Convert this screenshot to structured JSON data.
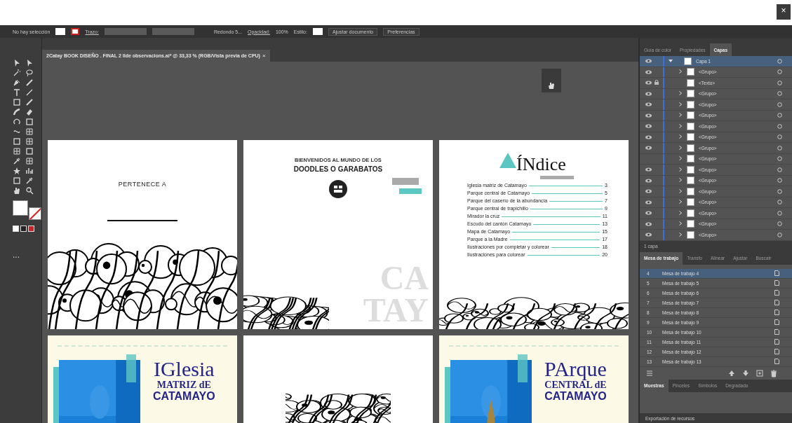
{
  "window": {
    "close": "×"
  },
  "control_bar": {
    "selection": "No hay selección",
    "stroke_label": "Trazo:",
    "brush": "Redondo 5...",
    "opacity_label": "Opacidad:",
    "opacity": "100%",
    "style_label": "Estilo:",
    "buttons": [
      "Ajustar documento",
      "Preferencias"
    ]
  },
  "document_tab": {
    "title": "2Catay BOOK DISEÑO . FINAL 2 Ilde observacions.ai* @ 33,33 % (RGB/Vista previa de CPU)",
    "close": "×"
  },
  "toolbar": {
    "more": "..."
  },
  "artboards": [
    {
      "kind": "owner",
      "title": "PERTENECE A"
    },
    {
      "kind": "welcome",
      "subtitle": "BIENVENIDOS AL MUNDO DE LOS",
      "title": "DOODLES O GARABATOS",
      "watermark": [
        "CA",
        "TAY"
      ]
    },
    {
      "kind": "index",
      "title": "ÍNdice",
      "entries": [
        {
          "label": "Iglesia matriz de Catamayo",
          "page": "3"
        },
        {
          "label": "Parque central de Catamayo",
          "page": "5"
        },
        {
          "label": "Parque del caserío de la abundancia",
          "page": "7"
        },
        {
          "label": "Parque central de trapichillo",
          "page": "9"
        },
        {
          "label": "Mirador la cruz",
          "page": "11"
        },
        {
          "label": "Escudo del cantón Catamayo",
          "page": "13"
        },
        {
          "label": "Mapa de Catamayo",
          "page": "15"
        },
        {
          "label": "Parque a la Madre",
          "page": "17"
        },
        {
          "label": "Ilustraciones por completar y colorear",
          "page": "18"
        },
        {
          "label": "Ilustraciones para colorear",
          "page": "20"
        }
      ]
    },
    {
      "kind": "place",
      "title": "IGlesia",
      "lines": [
        "MATRIZ dE",
        "CATAMAYO"
      ]
    },
    {
      "kind": "cover"
    },
    {
      "kind": "place",
      "title": "PArque",
      "lines": [
        "CENTRAL dE",
        "CATAMAYO"
      ]
    }
  ],
  "layers_panel": {
    "tabs": [
      {
        "label": "Guía de color",
        "selected": false
      },
      {
        "label": "Propiedades",
        "selected": false
      },
      {
        "label": "Capas",
        "selected": true
      }
    ],
    "rows": [
      {
        "kind": "layer",
        "name": "Capa 1",
        "selected": true,
        "visible": true,
        "locked": false
      },
      {
        "kind": "group",
        "name": "<Grupo>",
        "selected": false,
        "visible": true,
        "locked": false
      },
      {
        "kind": "item",
        "name": "<Texto>",
        "selected": false,
        "visible": true,
        "locked": true
      },
      {
        "kind": "group",
        "name": "<Grupo>",
        "selected": false,
        "visible": true,
        "locked": false
      },
      {
        "kind": "group",
        "name": "<Grupo>",
        "selected": false,
        "visible": true,
        "locked": false
      },
      {
        "kind": "group",
        "name": "<Grupo>",
        "selected": false,
        "visible": true,
        "locked": false
      },
      {
        "kind": "group",
        "name": "<Grupo>",
        "selected": false,
        "visible": true,
        "locked": false
      },
      {
        "kind": "group",
        "name": "<Grupo>",
        "selected": false,
        "visible": true,
        "locked": false
      },
      {
        "kind": "group",
        "name": "<Grupo>",
        "selected": false,
        "visible": true,
        "locked": false
      },
      {
        "kind": "group",
        "name": "<Grupo>",
        "selected": false,
        "visible": false,
        "locked": false
      },
      {
        "kind": "group",
        "name": "<Grupo>",
        "selected": false,
        "visible": true,
        "locked": false
      },
      {
        "kind": "group",
        "name": "<Grupo>",
        "selected": false,
        "visible": true,
        "locked": false
      },
      {
        "kind": "group",
        "name": "<Grupo>",
        "selected": false,
        "visible": true,
        "locked": false
      },
      {
        "kind": "group",
        "name": "<Grupo>",
        "selected": false,
        "visible": true,
        "locked": false
      },
      {
        "kind": "group",
        "name": "<Grupo>",
        "selected": false,
        "visible": true,
        "locked": false
      },
      {
        "kind": "group",
        "name": "<Grupo>",
        "selected": false,
        "visible": true,
        "locked": false
      },
      {
        "kind": "group",
        "name": "<Grupo>",
        "selected": false,
        "visible": true,
        "locked": false
      }
    ],
    "footer": "1 capa"
  },
  "artboards_panel": {
    "tabs": [
      {
        "label": "Mesa de trabajo",
        "selected": true
      },
      {
        "label": "Transfo",
        "selected": false
      },
      {
        "label": "Alinear",
        "selected": false
      },
      {
        "label": "Ajustar",
        "selected": false
      },
      {
        "label": "Buscatr",
        "selected": false
      }
    ],
    "rows": [
      {
        "number": "4",
        "name": "Mesa de trabajo 4",
        "selected": true
      },
      {
        "number": "5",
        "name": "Mesa de trabajo 5",
        "selected": false
      },
      {
        "number": "6",
        "name": "Mesa de trabajo 6",
        "selected": false
      },
      {
        "number": "7",
        "name": "Mesa de trabajo 7",
        "selected": false
      },
      {
        "number": "8",
        "name": "Mesa de trabajo 8",
        "selected": false
      },
      {
        "number": "9",
        "name": "Mesa de trabajo 9",
        "selected": false
      },
      {
        "number": "10",
        "name": "Mesa de trabajo 10",
        "selected": false
      },
      {
        "number": "11",
        "name": "Mesa de trabajo 11",
        "selected": false
      },
      {
        "number": "12",
        "name": "Mesa de trabajo 12",
        "selected": false
      },
      {
        "number": "13",
        "name": "Mesa de trabajo 13",
        "selected": false
      }
    ]
  },
  "swatches_panel": {
    "tabs": [
      {
        "label": "Muestras",
        "selected": true
      },
      {
        "label": "Pinceles",
        "selected": false
      },
      {
        "label": "Símbolos",
        "selected": false
      },
      {
        "label": "Degradado",
        "selected": false
      }
    ]
  },
  "export_panel": {
    "title": "Exportación de recursos"
  }
}
